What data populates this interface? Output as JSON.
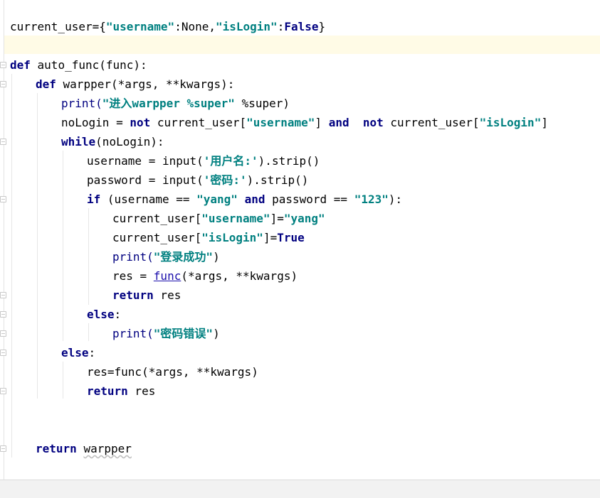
{
  "code": {
    "l1": {
      "a": "current_user={",
      "b": "\"username\"",
      "c": ":None,",
      "d": "\"isLogin\"",
      "e": ":",
      "f": "False",
      "g": "}"
    },
    "l3": {
      "a": "def",
      "b": " auto_func(func):"
    },
    "l4": {
      "a": "def",
      "b": " warpper(*args, **kwargs):"
    },
    "l5": {
      "a": "print(",
      "b": "\"进入warpper %super\"",
      "c": " %super)"
    },
    "l6": {
      "a": "noLogin = ",
      "b": "not",
      "c": " current_user[",
      "d": "\"username\"",
      "e": "] ",
      "f": "and",
      "g": "  ",
      "h": "not",
      "i": " current_user[",
      "j": "\"isLogin\"",
      "k": "]"
    },
    "l7": {
      "a": "while",
      "b": "(noLogin):"
    },
    "l8": {
      "a": "username = input(",
      "b": "'用户名:'",
      "c": ").strip()"
    },
    "l9": {
      "a": "password = input(",
      "b": "'密码:'",
      "c": ").strip()"
    },
    "l10": {
      "a": "if",
      "b": " (username == ",
      "c": "\"yang\"",
      "d": " ",
      "e": "and",
      "f": " password == ",
      "g": "\"123\"",
      "h": "):"
    },
    "l11": {
      "a": "current_user[",
      "b": "\"username\"",
      "c": "]=",
      "d": "\"yang\""
    },
    "l12": {
      "a": "current_user[",
      "b": "\"isLogin\"",
      "c": "]=",
      "d": "True"
    },
    "l13": {
      "a": "print(",
      "b": "\"登录成功\"",
      "c": ")"
    },
    "l14": {
      "a": "res = ",
      "b": "func",
      "c": "(*args, **kwargs)"
    },
    "l15": {
      "a": "return",
      "b": " res"
    },
    "l16": {
      "a": "else",
      "b": ":"
    },
    "l17": {
      "a": "print(",
      "b": "\"密码错误\"",
      "c": ")"
    },
    "l18": {
      "a": "else",
      "b": ":"
    },
    "l19": {
      "a": "res=func(*args, **kwargs)"
    },
    "l20": {
      "a": "return",
      "b": " res"
    },
    "l23": {
      "a": "return",
      "b": " ",
      "c": "warpper"
    }
  }
}
